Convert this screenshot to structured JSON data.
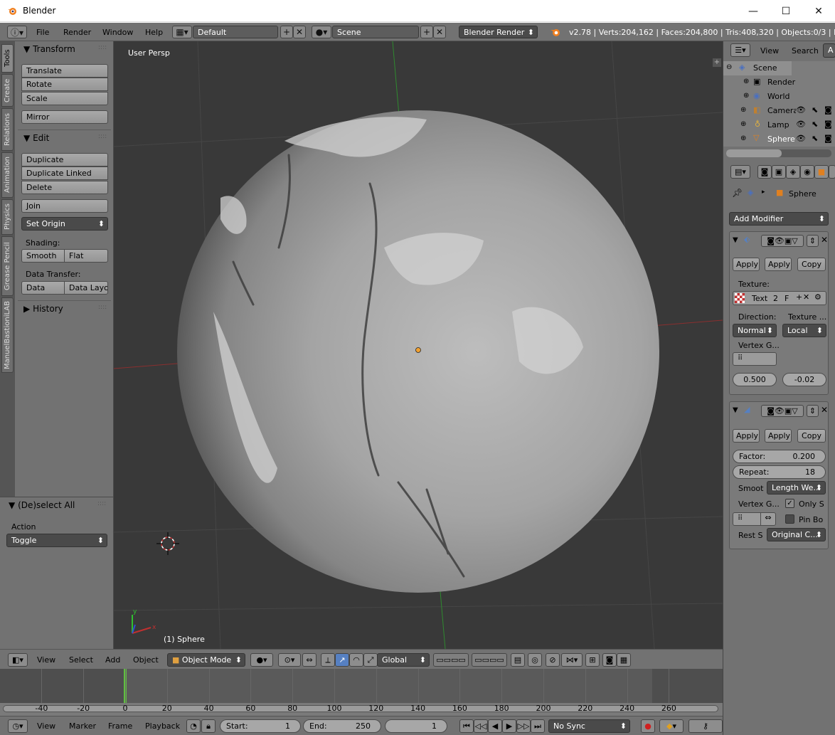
{
  "window": {
    "title": "Blender",
    "minimize": "—",
    "maximize": "☐",
    "close": "✕"
  },
  "info": {
    "menus": [
      "File",
      "Render",
      "Window",
      "Help"
    ],
    "layout": "Default",
    "scene": "Scene",
    "engine": "Blender Render",
    "stats": "v2.78 | Verts:204,162 | Faces:204,800 | Tris:408,320 | Objects:0/3 | Lamp"
  },
  "tabs": [
    "Tools",
    "Create",
    "Relations",
    "Animation",
    "Physics",
    "Grease Pencil",
    "ManuelBastioniLAB"
  ],
  "transform": {
    "header": "Transform",
    "buttons": [
      "Translate",
      "Rotate",
      "Scale"
    ],
    "mirror": "Mirror"
  },
  "edit": {
    "header": "Edit",
    "buttons": [
      "Duplicate",
      "Duplicate Linked",
      "Delete"
    ],
    "join": "Join",
    "set_origin": "Set Origin",
    "shading_label": "Shading:",
    "smooth": "Smooth",
    "flat": "Flat",
    "transfer_label": "Data Transfer:",
    "data": "Data",
    "data_layout": "Data Layo"
  },
  "history": {
    "header": "History"
  },
  "redo": {
    "header": "(De)select All",
    "action_label": "Action",
    "action_value": "Toggle"
  },
  "viewport": {
    "label": "User Persp",
    "object_label": "(1) Sphere"
  },
  "view3d_header": {
    "menus": [
      "View",
      "Select",
      "Add",
      "Object"
    ],
    "mode": "Object Mode",
    "orientation": "Global"
  },
  "timeline": {
    "ticks": [
      "-40",
      "-20",
      "0",
      "20",
      "40",
      "60",
      "80",
      "100",
      "120",
      "140",
      "160",
      "180",
      "200",
      "220",
      "240",
      "260"
    ],
    "current_frame": 1,
    "menus": [
      "View",
      "Marker",
      "Frame",
      "Playback"
    ],
    "start_label": "Start:",
    "start": "1",
    "end_label": "End:",
    "end": "250",
    "frame": "1",
    "sync": "No Sync"
  },
  "outliner": {
    "menus": [
      "View",
      "Search"
    ],
    "items": [
      {
        "label": "Scene",
        "icon": "scene-icon",
        "level": 0
      },
      {
        "label": "Render",
        "icon": "render-icon",
        "level": 1
      },
      {
        "label": "World",
        "icon": "world-icon",
        "level": 1
      },
      {
        "label": "Camera",
        "icon": "camera-icon",
        "level": 1
      },
      {
        "label": "Lamp",
        "icon": "lamp-icon",
        "level": 1
      },
      {
        "label": "Sphere",
        "icon": "mesh-icon",
        "level": 1
      }
    ]
  },
  "properties": {
    "object_name": "Sphere",
    "add_modifier": "Add Modifier",
    "mod1": {
      "apply1": "Apply",
      "apply2": "Apply",
      "copy": "Copy",
      "texture_label": "Texture:",
      "texture_name": "Text",
      "users": "2",
      "fake": "F",
      "direction_label": "Direction:",
      "texture_coords_label": "Texture ...",
      "direction": "Normal",
      "coords": "Local",
      "vgroup_label": "Vertex G...",
      "midlevel": "0.500",
      "strength": "-0.02"
    },
    "mod2": {
      "apply1": "Apply",
      "apply2": "Apply",
      "copy": "Copy",
      "factor_label": "Factor:",
      "factor": "0.200",
      "repeat_label": "Repeat:",
      "repeat": "18",
      "smooth_label": "Smoot",
      "smooth_value": "Length We...",
      "vgroup_label": "Vertex G...",
      "only_smooth": "Only S",
      "pin_boundary": "Pin Bo",
      "rest_label": "Rest S",
      "rest_value": "Original C..."
    }
  },
  "colors": {
    "accent": "#5680c2",
    "timeline_cursor": "#60c040",
    "axis_x": "#a03030",
    "axis_y": "#30a030"
  }
}
